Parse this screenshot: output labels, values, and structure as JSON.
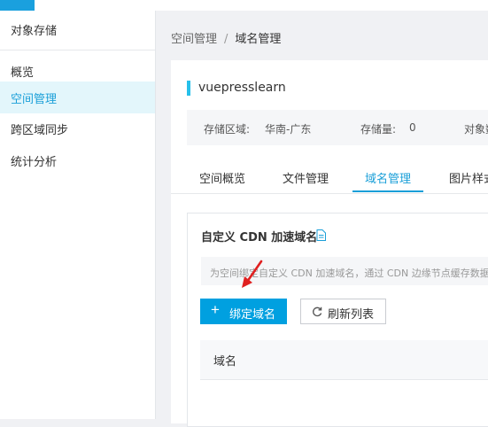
{
  "sidebar": {
    "title": "对象存储",
    "items": [
      {
        "label": "概览"
      },
      {
        "label": "空间管理",
        "active": true
      },
      {
        "label": "跨区域同步"
      },
      {
        "label": "统计分析"
      }
    ]
  },
  "breadcrumb": {
    "parent": "空间管理",
    "separator": "/",
    "current": "域名管理"
  },
  "bucket": {
    "name": "vuepresslearn",
    "region_label": "存储区域:",
    "region_value": "华南-广东",
    "storage_label": "存储量:",
    "storage_value": "0",
    "objects_label": "对象数"
  },
  "tabs": [
    {
      "label": "空间概览"
    },
    {
      "label": "文件管理"
    },
    {
      "label": "域名管理",
      "active": true
    },
    {
      "label": "图片样式"
    }
  ],
  "panel": {
    "title": "自定义 CDN 加速域名",
    "notice": "为空间绑定自定义 CDN 加速域名，通过 CDN 边缘节点缓存数据，",
    "bind_button": "绑定域名",
    "refresh_button": "刷新列表",
    "table_header": "域名"
  },
  "icons": {
    "doc": "document-icon",
    "plus": "plus-icon",
    "refresh": "refresh-icon",
    "arrow": "annotation-arrow-icon"
  },
  "colors": {
    "accent": "#1a9fd8",
    "primary_button": "#00a0e0",
    "arrow": "#e02020"
  }
}
